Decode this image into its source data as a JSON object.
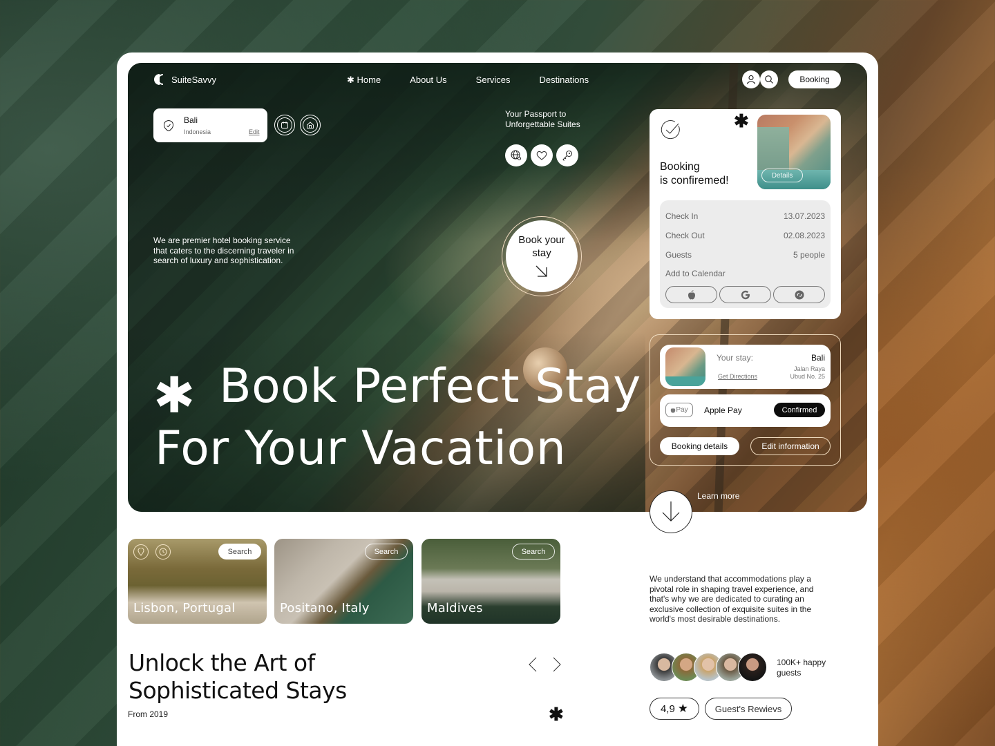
{
  "app": {
    "name": "SuiteSavvy"
  },
  "nav": {
    "items": [
      {
        "label": "✱ Home",
        "active": true
      },
      {
        "label": "About Us"
      },
      {
        "label": "Services"
      },
      {
        "label": "Destinations"
      }
    ],
    "booking_label": "Booking",
    "icons": [
      "user-icon",
      "search-icon"
    ]
  },
  "location": {
    "city": "Bali",
    "country": "Indonesia",
    "edit_label": "Edit",
    "icons": [
      "calendar-icon",
      "home-icon"
    ]
  },
  "passport": {
    "text_line1": "Your Passport to",
    "text_line2": "Unforgettable Suites",
    "icons": [
      "globe-search-icon",
      "heart-icon",
      "key-icon"
    ]
  },
  "intro": "We are premier hotel booking service that caters to the discerning traveler in search of luxury and sophistication.",
  "book_stay": {
    "line1": "Book your",
    "line2": "stay",
    "icon": "arrow-down-right-icon"
  },
  "headline": {
    "star": "✱",
    "line1": "Book Perfect Stay",
    "line2": "For Your Vacation"
  },
  "confirmation": {
    "title_line1": "Booking",
    "title_line2": "is confiremed!",
    "asterisk": "✱",
    "details_label": "Details",
    "rows": [
      {
        "label": "Check In",
        "value": "13.07.2023"
      },
      {
        "label": "Check Out",
        "value": "02.08.2023"
      },
      {
        "label": "Guests",
        "value": "5 people"
      }
    ],
    "add_calendar_label": "Add to Calendar",
    "calendar_options": [
      "apple-icon",
      "google-icon",
      "other-calendar-icon"
    ]
  },
  "stay": {
    "label": "Your stay:",
    "place": "Bali",
    "address_line1": "Jalan Raya",
    "address_line2": "Ubud No. 25",
    "directions_label": "Get Directions",
    "payment_badge": "Pay",
    "payment_method": "Apple Pay",
    "payment_status": "Confirmed",
    "booking_details_label": "Booking details",
    "edit_info_label": "Edit information"
  },
  "learn_more": "Learn more",
  "destinations": [
    {
      "name": "Lisbon, Portugal",
      "search_label": "Search"
    },
    {
      "name": "Positano, Italy",
      "search_label": "Search"
    },
    {
      "name": "Maldives",
      "search_label": "Search"
    }
  ],
  "section": {
    "title_line1": "Unlock the Art of",
    "title_line2": "Sophisticated Stays",
    "since": "From 2019",
    "asterisk": "✱"
  },
  "about_text": "We understand that accommodations play a pivotal role in shaping travel experience, and that's why we are dedicated to curating an exclusive collection of exquisite suites in the world's most desirable destinations.",
  "social": {
    "guests_line1": "100K+ happy",
    "guests_line2": "guests",
    "rating": "4,9",
    "star": "★",
    "reviews_label": "Guest's Rewievs"
  },
  "colors": {
    "accent_gold": "#f0dcc0",
    "dark": "#0d0d0d",
    "panel_gray": "#ececec"
  }
}
